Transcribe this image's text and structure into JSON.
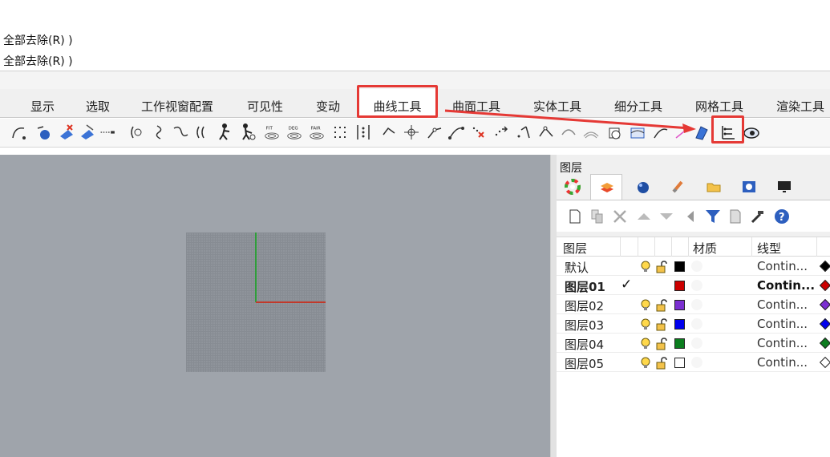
{
  "command_history": {
    "line1": "全部去除(R) )",
    "line2": "全部去除(R) )"
  },
  "tabs": [
    {
      "label": "显示"
    },
    {
      "label": "选取"
    },
    {
      "label": "工作视窗配置"
    },
    {
      "label": "可见性"
    },
    {
      "label": "变动"
    },
    {
      "label": "曲线工具",
      "active": true
    },
    {
      "label": "曲面工具"
    },
    {
      "label": "实体工具"
    },
    {
      "label": "细分工具"
    },
    {
      "label": "网格工具"
    },
    {
      "label": "渲染工具"
    }
  ],
  "toolbar": {
    "fit_label": "FIT",
    "deg_label": "DEG",
    "fair_label": "FAIR"
  },
  "annotations": {
    "highlight_color": "#e53935"
  },
  "layers_panel": {
    "title": "图层",
    "tab_icons": [
      "color-wheel-icon",
      "layers-icon",
      "material-sphere-icon",
      "brush-icon",
      "folder-icon",
      "help-panel-icon",
      "display-icon"
    ],
    "toolbar_icons": [
      "new-layer-icon",
      "new-sublayer-icon",
      "delete-icon",
      "move-up-icon",
      "move-down-icon",
      "move-to-parent-icon",
      "filter-icon",
      "document-icon",
      "tools-icon",
      "help-icon"
    ],
    "columns": {
      "layer": "图层",
      "material": "材质",
      "linetype": "线型"
    },
    "layers": [
      {
        "name": "默认",
        "current": false,
        "visible": true,
        "locked": false,
        "color": "#000000",
        "linetype": "Contin...",
        "print_color": "#000000"
      },
      {
        "name": "图层01",
        "current": true,
        "visible": true,
        "locked": false,
        "color": "#cc0000",
        "linetype": "Contin...",
        "print_color": "#cc0000"
      },
      {
        "name": "图层02",
        "current": false,
        "visible": true,
        "locked": false,
        "color": "#7b2fd1",
        "linetype": "Contin...",
        "print_color": "#7b2fd1"
      },
      {
        "name": "图层03",
        "current": false,
        "visible": true,
        "locked": false,
        "color": "#0000ee",
        "linetype": "Contin...",
        "print_color": "#0000ee"
      },
      {
        "name": "图层04",
        "current": false,
        "visible": true,
        "locked": false,
        "color": "#0b7d1e",
        "linetype": "Contin...",
        "print_color": "#0b7d1e"
      },
      {
        "name": "图层05",
        "current": false,
        "visible": true,
        "locked": false,
        "color": "#ffffff",
        "linetype": "Contin...",
        "print_color": "#ffffff"
      }
    ]
  }
}
